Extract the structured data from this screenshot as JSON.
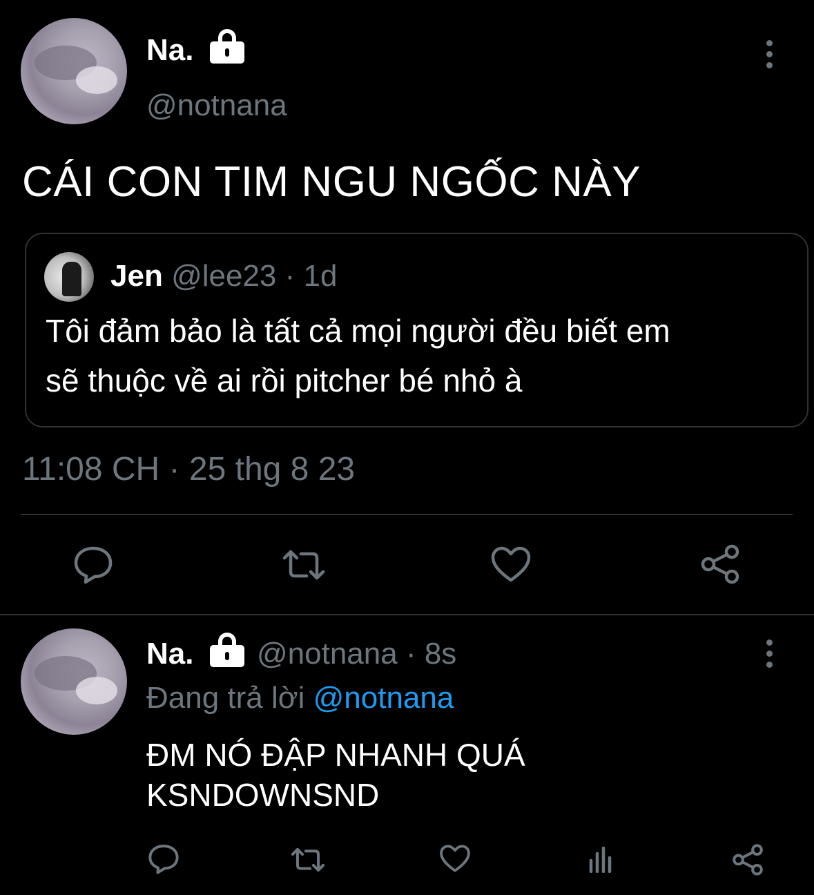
{
  "tweet": {
    "display_name": "Na.",
    "handle": "@notnana",
    "text": "CÁI CON TIM NGU NGỐC NÀY",
    "timestamp": "11:08 CH · 25 thg 8 23",
    "quoted": {
      "display_name": "Jen",
      "handle": "@lee23",
      "age": "· 1d",
      "text_line1": "Tôi đảm bảo là tất cả mọi người đều biết em",
      "text_line2": "sẽ thuộc về ai rồi pitcher bé nhỏ à"
    },
    "actions": [
      "reply-icon",
      "retweet-icon",
      "like-icon",
      "share-icon"
    ]
  },
  "reply": {
    "display_name": "Na.",
    "handle": "@notnana",
    "age": "· 8s",
    "replying_label": "Đang trả lời",
    "replying_to": "@notnana",
    "text_line1": "ĐM NÓ ĐẬP NHANH QUÁ",
    "text_line2": "KSNDOWNSND",
    "actions": [
      "reply-icon",
      "retweet-icon",
      "like-icon",
      "analytics-icon",
      "share-icon"
    ]
  },
  "colors": {
    "background": "#000000",
    "secondary_text": "#6e767d",
    "link": "#1d9bf0",
    "border": "#2f3336"
  }
}
